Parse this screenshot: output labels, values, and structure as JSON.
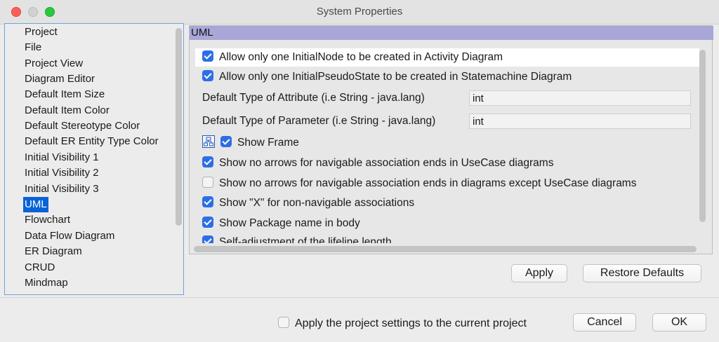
{
  "window": {
    "title": "System Properties"
  },
  "nav": {
    "items": [
      "Project",
      "File",
      "Project View",
      "Diagram Editor",
      "Default Item Size",
      "Default Item Color",
      "Default Stereotype Color",
      "Default ER Entity Type Color",
      "Initial Visibility 1",
      "Initial Visibility 2",
      "Initial Visibility 3",
      "UML",
      "Flowchart",
      "Data Flow Diagram",
      "ER Diagram",
      "CRUD",
      "Mindmap"
    ],
    "selected": "UML"
  },
  "panel": {
    "header": "UML",
    "opt_initial_node": "Allow only one InitialNode to be created in Activity Diagram",
    "opt_initial_pseudostate": "Allow only one InitialPseudoState to be created in Statemachine Diagram",
    "attr_type_label": "Default Type of Attribute (i.e String - java.lang)",
    "attr_type_value": "int",
    "param_type_label": "Default Type of Parameter (i.e String - java.lang)",
    "param_type_value": "int",
    "show_frame": "Show Frame",
    "opt_no_arrows_usecase": "Show no arrows for navigable association ends in UseCase diagrams",
    "opt_no_arrows_except": "Show no arrows for navigable association ends in diagrams except UseCase diagrams",
    "opt_show_x": "Show \"X\" for non-navigable associations",
    "opt_package_name": "Show Package name in body",
    "opt_lifeline": "Self-adjustment of the lifeline length"
  },
  "checks": {
    "opt_initial_node": true,
    "opt_initial_pseudostate": true,
    "show_frame": true,
    "opt_no_arrows_usecase": true,
    "opt_no_arrows_except": false,
    "opt_show_x": true,
    "opt_package_name": true,
    "opt_lifeline": true,
    "apply_project": false
  },
  "buttons": {
    "apply": "Apply",
    "restore": "Restore Defaults",
    "cancel": "Cancel",
    "ok": "OK"
  },
  "footer": {
    "apply_project": "Apply the project settings to the current project"
  },
  "colors": {
    "accent": "#2d6ee6",
    "selection": "#0a63d6",
    "header": "#a9a6d8"
  }
}
